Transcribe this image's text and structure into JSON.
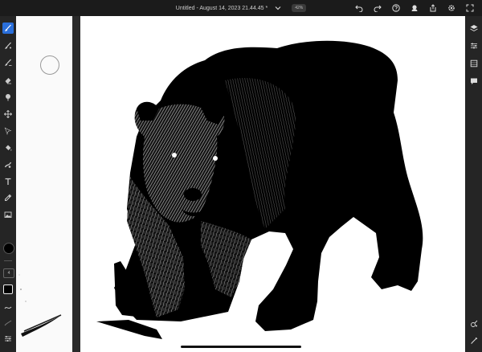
{
  "document": {
    "title": "Untitled - August 14, 2023 21.44.45 *",
    "zoom": "42%"
  },
  "colors": {
    "accent": "#2a6fdb",
    "active_color": "#000000",
    "canvas": "#ffffff",
    "chrome": "#1e1e1e"
  },
  "top_toolbar": {
    "icons": [
      "undo-icon",
      "redo-icon",
      "help-icon",
      "cloud-sync-icon",
      "share-icon",
      "settings-icon",
      "fullscreen-icon"
    ]
  },
  "left_toolbar": {
    "tools": [
      "pixel-brush",
      "live-brush",
      "vector-brush",
      "eraser",
      "smudge",
      "transform",
      "selection",
      "fill",
      "liquify",
      "text",
      "eyedropper",
      "image",
      "color",
      "size",
      "opacity",
      "smoothing",
      "brush-settings",
      "adjustments"
    ],
    "active_tool": "pixel-brush",
    "size_value": "4"
  },
  "right_toolbar": {
    "icons": [
      "layers-icon",
      "layer-properties-icon",
      "fill-panel-icon",
      "comments-icon",
      "reference-icon",
      "touch-shortcut-icon"
    ]
  }
}
